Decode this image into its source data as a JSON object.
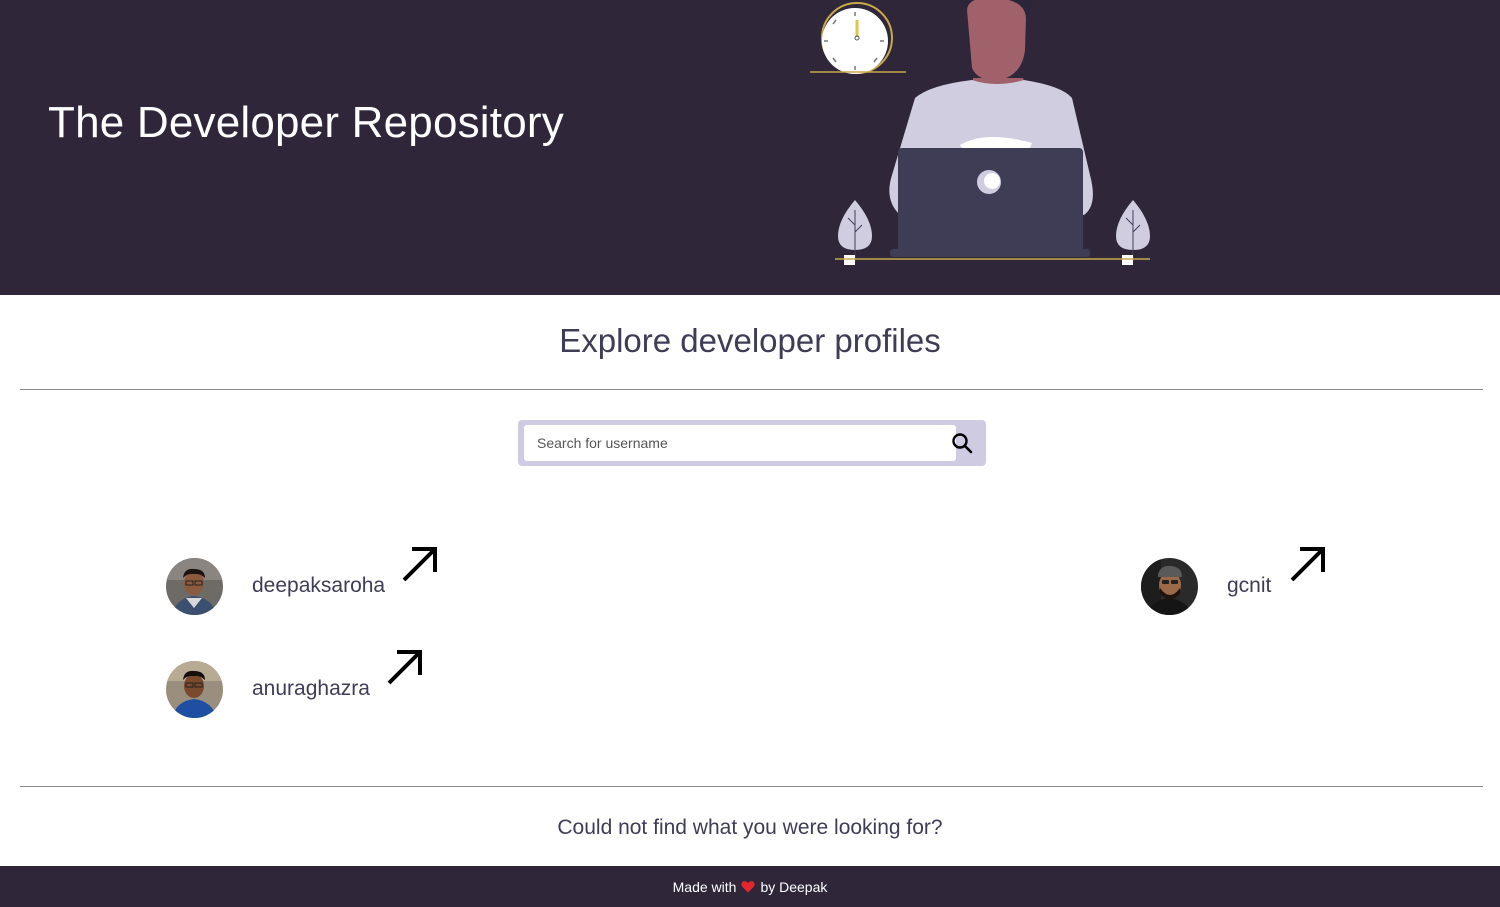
{
  "header": {
    "title": "The Developer Repository"
  },
  "main": {
    "section_title": "Explore developer profiles",
    "search": {
      "placeholder": "Search for username",
      "value": ""
    },
    "profiles": [
      {
        "username": "deepaksaroha"
      },
      {
        "username": "gcnit"
      },
      {
        "username": "anuraghazra"
      }
    ],
    "not_found_text": "Could not find what you were looking for?"
  },
  "footer": {
    "made_with": "Made with",
    "by": "by Deepak"
  },
  "colors": {
    "header_bg": "#2f2639",
    "footer_bg": "#2f2639",
    "search_frame": "#cfcbe3",
    "text": "#3f3d56",
    "heart": "#e5262f"
  },
  "icons": {
    "search": "search-icon",
    "open_profile": "arrow-up-right-icon",
    "heart": "heart-icon"
  }
}
